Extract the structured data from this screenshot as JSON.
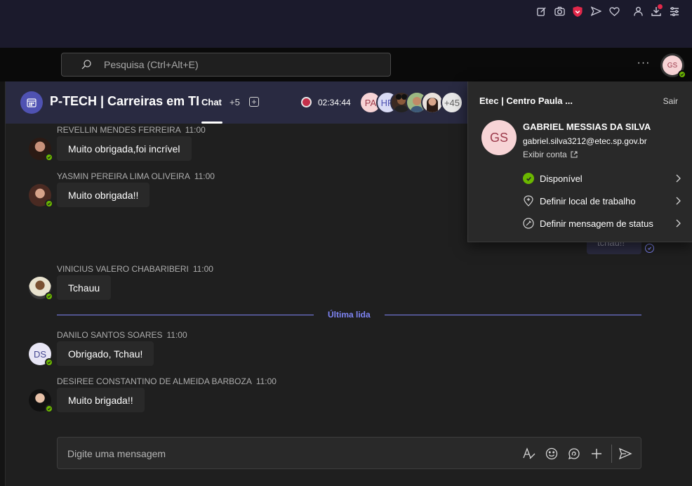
{
  "browser": {
    "icons": [
      "edit-icon",
      "camera-icon",
      "shield-icon",
      "send-icon",
      "heart-icon",
      "profile-icon",
      "download-icon",
      "menu-icon"
    ]
  },
  "topbar": {
    "search_placeholder": "Pesquisa (Ctrl+Alt+E)",
    "more": "···",
    "avatar_initials": "GS"
  },
  "meeting": {
    "title": "P-TECH | Carreiras em TI",
    "tab_chat": "Chat",
    "tab_more": "+5",
    "tab_add": "+",
    "recording_time": "02:34:44",
    "participants": {
      "pa": "PA",
      "hr": "HR",
      "more_count": "+45"
    }
  },
  "messages": [
    {
      "author": "REVELLIN MENDES FERREIRA",
      "time": "11:00",
      "text": "Muito obrigada,foi incrível"
    },
    {
      "author": "YASMIN PEREIRA LIMA OLIVEIRA",
      "time": "11:00",
      "text": "Muito obrigada!!"
    },
    {
      "author": "VINICIUS VALERO CHABARIBERI",
      "time": "11:00",
      "text": "Tchauu"
    },
    {
      "author": "DANILO SANTOS SOARES",
      "time": "11:00",
      "text": "Obrigado, Tchau!",
      "initials": "DS"
    },
    {
      "author": "DESIREE CONSTANTINO DE ALMEIDA BARBOZA",
      "time": "11:00",
      "text": "Muito brigada!!"
    }
  ],
  "own_message_partial": "tchau!!",
  "last_read_label": "Última lida",
  "composer": {
    "placeholder": "Digite uma mensagem"
  },
  "profile": {
    "org": "Etec | Centro Paula ...",
    "sign_out": "Sair",
    "initials": "GS",
    "name": "GABRIEL MESSIAS DA SILVA",
    "email": "gabriel.silva3212@etec.sp.gov.br",
    "view_account": "Exibir conta",
    "status_available": "Disponível",
    "set_work_location": "Definir local de trabalho",
    "set_status_message": "Definir mensagem de status"
  },
  "colors": {
    "accent": "#7f85f5",
    "available": "#6bb700",
    "header_bg": "#292a41",
    "record": "#c4314b"
  }
}
